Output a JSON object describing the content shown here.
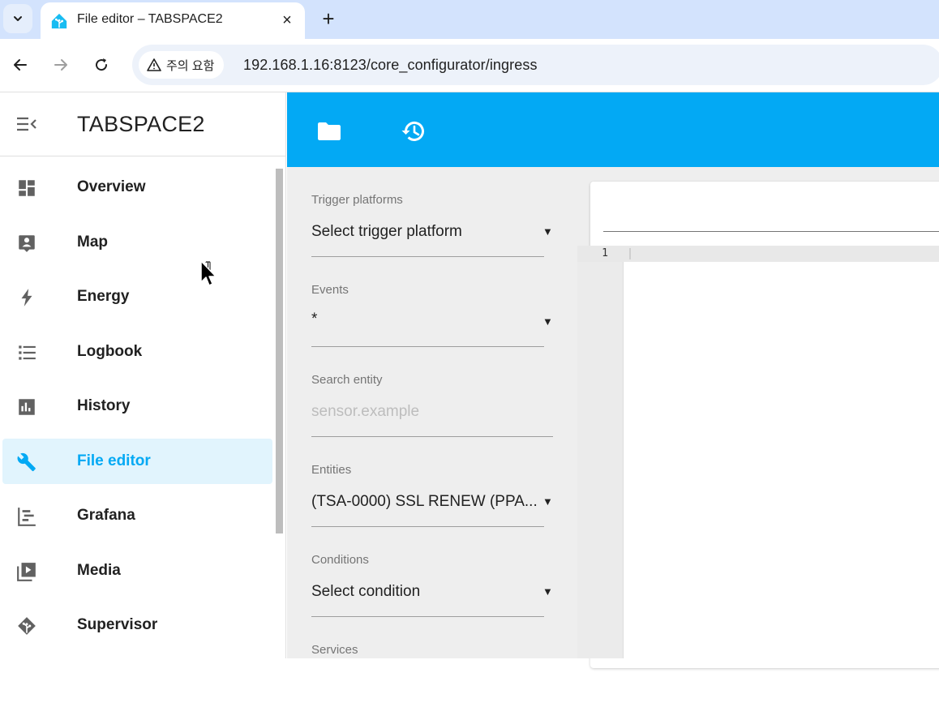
{
  "browser": {
    "tab_title": "File editor – TABSPACE2",
    "close_glyph": "×",
    "new_tab_glyph": "+",
    "security_label": "주의 요함",
    "url": "192.168.1.16:8123/core_configurator/ingress",
    "back_glyph": "←",
    "forward_glyph": "→",
    "reload_glyph": "↻"
  },
  "sidebar": {
    "title": "TABSPACE2",
    "items": [
      {
        "label": "Overview",
        "icon": "view-dashboard-icon"
      },
      {
        "label": "Map",
        "icon": "map-account-icon"
      },
      {
        "label": "Energy",
        "icon": "lightning-bolt-icon"
      },
      {
        "label": "Logbook",
        "icon": "format-list-bulleted-icon"
      },
      {
        "label": "History",
        "icon": "chart-box-icon"
      },
      {
        "label": "File editor",
        "icon": "wrench-icon",
        "active": true
      },
      {
        "label": "Grafana",
        "icon": "chart-timeline-icon"
      },
      {
        "label": "Media",
        "icon": "play-box-multiple-icon"
      },
      {
        "label": "Supervisor",
        "icon": "home-assistant-icon"
      }
    ]
  },
  "appbar": {
    "buttons": [
      "folder-icon",
      "history-icon"
    ],
    "color": "#03a9f4"
  },
  "form": {
    "trigger_platforms": {
      "label": "Trigger platforms",
      "value": "Select trigger platform"
    },
    "events": {
      "label": "Events",
      "value": "*"
    },
    "search_entity": {
      "label": "Search entity",
      "placeholder": "sensor.example"
    },
    "entities": {
      "label": "Entities",
      "value": "(TSA-0000) SSL RENEW (PPA..."
    },
    "conditions": {
      "label": "Conditions",
      "value": "Select condition"
    },
    "services": {
      "label": "Services"
    }
  },
  "editor": {
    "line_numbers": [
      "1"
    ]
  },
  "colors": {
    "accent": "#03a9f4",
    "active_nav_bg": "#e1f4fd"
  }
}
